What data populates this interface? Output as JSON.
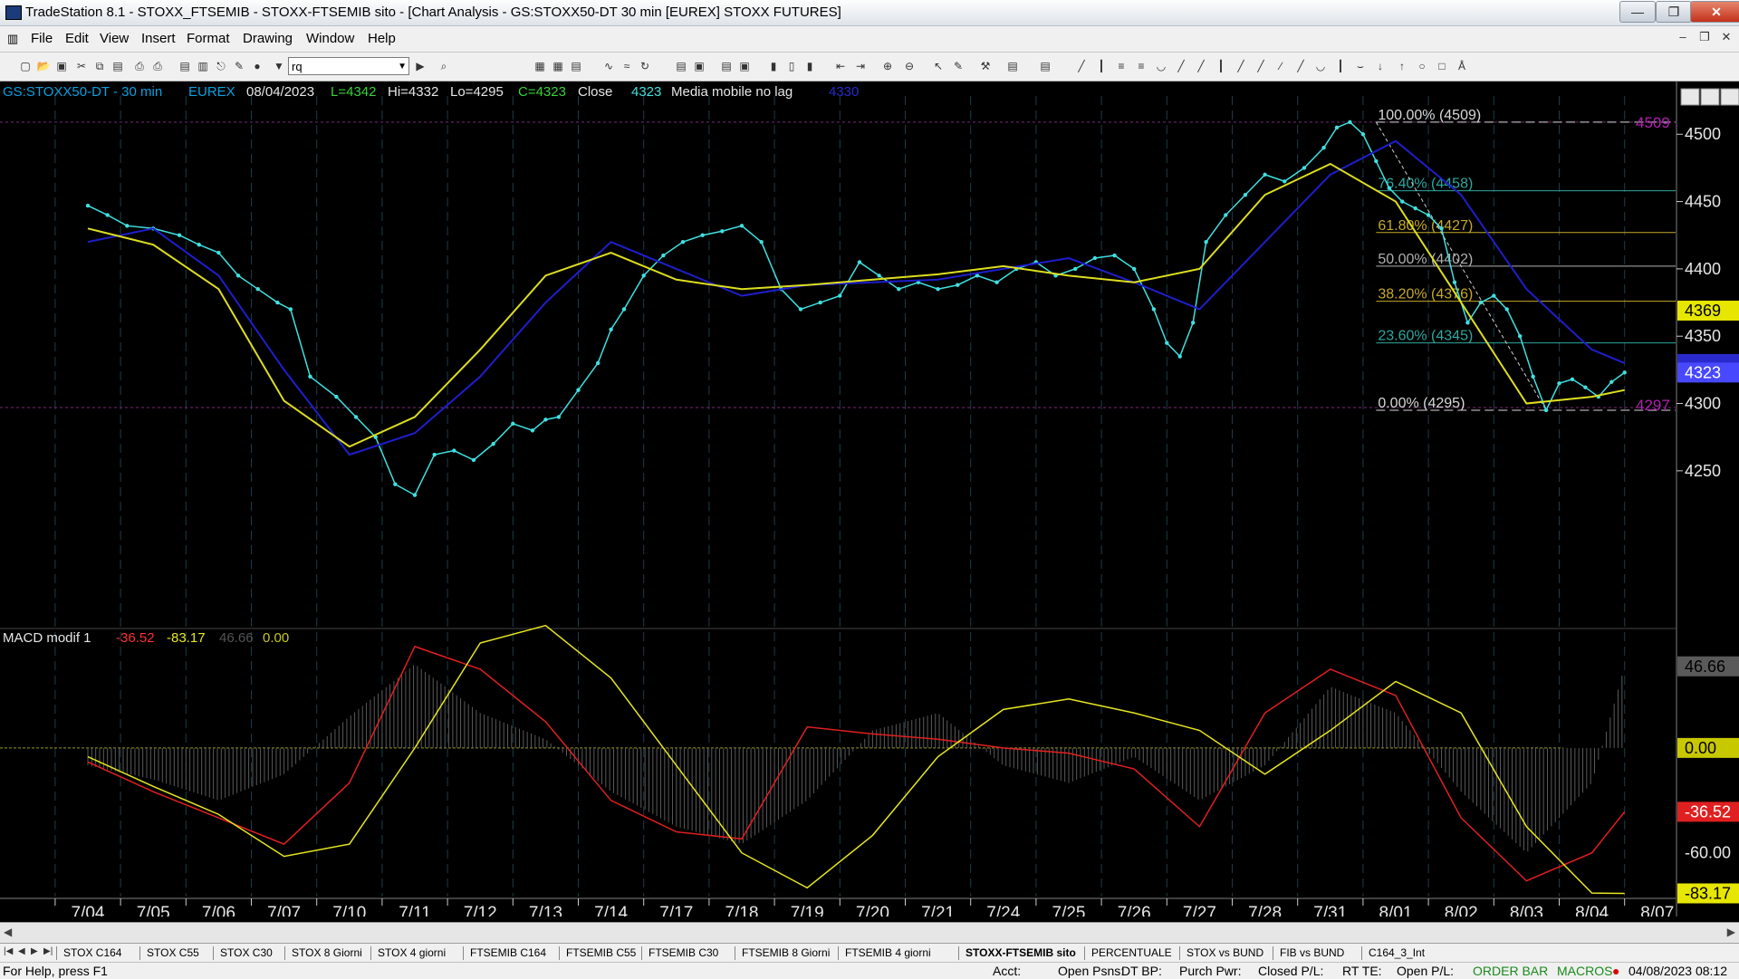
{
  "window": {
    "title": "TradeStation 8.1 - STOXX_FTSEMIB - STOXX-FTSEMIB sito - [Chart Analysis - GS:STOXX50-DT  30 min  [EUREX] STOXX FUTURES]",
    "buttons": [
      "minimize",
      "maximize",
      "close"
    ]
  },
  "menu": [
    "File",
    "Edit",
    "View",
    "Insert",
    "Format",
    "Drawing",
    "Window",
    "Help"
  ],
  "toolbar": {
    "combo_value": "rq"
  },
  "header": {
    "symbol": "GS:STOXX50-DT - 30 min",
    "exchange": "EUREX",
    "date": "08/04/2023",
    "last": "L=4342",
    "high": "Hi=4332",
    "low": "Lo=4295",
    "close": "C=4323",
    "close_label": "Close",
    "close_value": "4323",
    "indicator": "Media mobile no lag",
    "indicator_value": "4330"
  },
  "price_axis": {
    "ticks": [
      "4500",
      "4450",
      "4400",
      "4350",
      "4300",
      "4250"
    ],
    "tick_values": [
      4500,
      4450,
      4400,
      4350,
      4300,
      4250
    ],
    "tags": {
      "fib_top": "4509",
      "yellow": "4369",
      "blue": "4323",
      "blue_hidden": "4330",
      "fib_bottom": "4297"
    }
  },
  "fib": [
    {
      "label": "100.00% (4509)",
      "value": 4509,
      "color": "#d8d8d8"
    },
    {
      "label": "76.40% (4458)",
      "value": 4458,
      "color": "#2fa7a0"
    },
    {
      "label": "61.80% (4427)",
      "value": 4427,
      "color": "#c7a92a"
    },
    {
      "label": "50.00% (4402)",
      "value": 4402,
      "color": "#b0b0b0"
    },
    {
      "label": "38.20% (4376)",
      "value": 4376,
      "color": "#c7a92a"
    },
    {
      "label": "23.60% (4345)",
      "value": 4345,
      "color": "#2fa7a0"
    },
    {
      "label": "0.00% (4295)",
      "value": 4295,
      "color": "#d8d8d8"
    }
  ],
  "macd": {
    "title": "MACD modif 1",
    "v1": "-36.52",
    "v2": "-83.17",
    "v3": "46.66",
    "v4": "0.00",
    "axis_ticks": [
      "-60.00"
    ],
    "tags": {
      "hist": "46.66",
      "zero": "0.00",
      "macd": "-36.52",
      "signal": "-83.17"
    }
  },
  "dates": [
    "7/04",
    "7/05",
    "7/06",
    "7/07",
    "7/10",
    "7/11",
    "7/12",
    "7/13",
    "7/14",
    "7/17",
    "7/18",
    "7/19",
    "7/20",
    "7/21",
    "7/24",
    "7/25",
    "7/26",
    "7/27",
    "7/28",
    "7/31",
    "8/01",
    "8/02",
    "8/03",
    "8/04",
    "8/07"
  ],
  "chart_data": {
    "type": "line",
    "title": "GS:STOXX50-DT - 30 min",
    "x_labels": [
      "7/04",
      "7/05",
      "7/06",
      "7/07",
      "7/10",
      "7/11",
      "7/12",
      "7/13",
      "7/14",
      "7/17",
      "7/18",
      "7/19",
      "7/20",
      "7/21",
      "7/24",
      "7/25",
      "7/26",
      "7/27",
      "7/28",
      "7/31",
      "8/01",
      "8/02",
      "8/03",
      "8/04",
      "8/07"
    ],
    "ylim": [
      4223,
      4519
    ],
    "series": [
      {
        "name": "Close",
        "color": "#40e0e0",
        "x": [
          0.0,
          0.3,
          0.6,
          1.0,
          1.4,
          1.7,
          2.0,
          2.3,
          2.6,
          2.9,
          3.1,
          3.4,
          3.8,
          4.1,
          4.4,
          4.7,
          5.0,
          5.3,
          5.6,
          5.9,
          6.2,
          6.5,
          6.8,
          7.0,
          7.2,
          7.5,
          7.8,
          8.0,
          8.2,
          8.5,
          8.8,
          9.1,
          9.4,
          9.7,
          10.0,
          10.3,
          10.6,
          10.9,
          11.2,
          11.5,
          11.8,
          12.1,
          12.4,
          12.7,
          13.0,
          13.3,
          13.6,
          13.9,
          14.2,
          14.5,
          14.8,
          15.1,
          15.4,
          15.7,
          16.0,
          16.3,
          16.5,
          16.7,
          16.9,
          17.1,
          17.4,
          17.7,
          18.0,
          18.3,
          18.6,
          18.9,
          19.1,
          19.3,
          19.5,
          19.7,
          19.9,
          20.1,
          20.3,
          20.5,
          20.7,
          20.9,
          21.1,
          21.3,
          21.5,
          21.7,
          21.9,
          22.1,
          22.3,
          22.5,
          22.7,
          22.9,
          23.1,
          23.3,
          23.5
        ],
        "values": [
          4447,
          4440,
          4432,
          4430,
          4425,
          4418,
          4412,
          4395,
          4385,
          4375,
          4370,
          4320,
          4305,
          4290,
          4275,
          4240,
          4232,
          4262,
          4265,
          4258,
          4270,
          4285,
          4280,
          4288,
          4290,
          4310,
          4330,
          4355,
          4370,
          4395,
          4410,
          4420,
          4425,
          4428,
          4432,
          4420,
          4385,
          4370,
          4375,
          4380,
          4405,
          4395,
          4385,
          4390,
          4385,
          4388,
          4395,
          4390,
          4400,
          4405,
          4395,
          4400,
          4408,
          4410,
          4400,
          4370,
          4345,
          4335,
          4360,
          4420,
          4440,
          4455,
          4470,
          4465,
          4475,
          4490,
          4505,
          4509,
          4500,
          4480,
          4460,
          4450,
          4445,
          4440,
          4430,
          4390,
          4360,
          4375,
          4380,
          4370,
          4350,
          4320,
          4295,
          4315,
          4318,
          4312,
          4305,
          4316,
          4323
        ]
      },
      {
        "name": "Media mobile no lag",
        "color": "#1e1ecc",
        "x": [
          0,
          1,
          2,
          3,
          4,
          5,
          6,
          7,
          8,
          9,
          10,
          11,
          12,
          13,
          14,
          15,
          16,
          17,
          18,
          19,
          20,
          21,
          22,
          23,
          23.5
        ],
        "values": [
          4420,
          4430,
          4395,
          4325,
          4262,
          4278,
          4320,
          4375,
          4420,
          4400,
          4380,
          4388,
          4390,
          4392,
          4400,
          4408,
          4390,
          4370,
          4420,
          4470,
          4495,
          4455,
          4385,
          4340,
          4330
        ]
      },
      {
        "name": "",
        "color": "#dede20",
        "x": [
          0,
          1,
          2,
          3,
          4,
          5,
          6,
          7,
          8,
          9,
          10,
          11,
          12,
          13,
          14,
          15,
          16,
          17,
          18,
          19,
          20,
          21,
          22,
          23,
          23.5
        ],
        "values": [
          4430,
          4418,
          4385,
          4302,
          4268,
          4290,
          4340,
          4395,
          4412,
          4392,
          4385,
          4388,
          4392,
          4396,
          4402,
          4395,
          4390,
          4400,
          4455,
          4478,
          4450,
          4375,
          4300,
          4305,
          4310
        ]
      }
    ],
    "macd_panel": {
      "title": "MACD modif 1",
      "ylim": [
        -85,
        60
      ],
      "x": [
        0,
        1,
        2,
        3,
        4,
        5,
        6,
        7,
        8,
        9,
        10,
        11,
        12,
        13,
        14,
        15,
        16,
        17,
        18,
        19,
        20,
        21,
        22,
        23,
        23.5
      ],
      "histogram": [
        -10,
        -18,
        -30,
        -15,
        18,
        48,
        20,
        5,
        -25,
        -45,
        -55,
        -30,
        10,
        20,
        -10,
        -20,
        -5,
        -30,
        -10,
        35,
        20,
        -25,
        -60,
        -20,
        46.66
      ],
      "macd": [
        -8,
        -25,
        -40,
        -55,
        -20,
        58,
        45,
        15,
        -30,
        -48,
        -52,
        12,
        8,
        5,
        0,
        -3,
        -12,
        -45,
        20,
        45,
        30,
        -40,
        -76,
        -60,
        -36.52
      ],
      "signal": [
        -5,
        -22,
        -38,
        -62,
        -55,
        0,
        60,
        70,
        40,
        -10,
        -60,
        -80,
        -50,
        -5,
        22,
        28,
        20,
        10,
        -15,
        10,
        38,
        20,
        -45,
        -83,
        -83.17
      ]
    }
  }
}
